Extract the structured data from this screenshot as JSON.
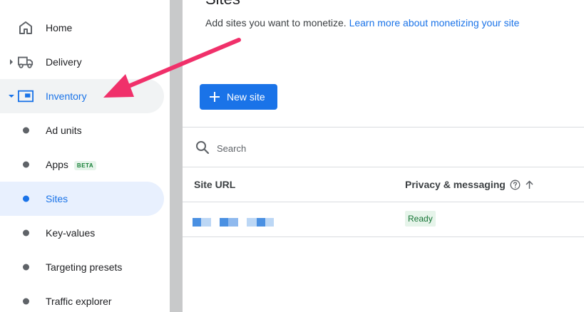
{
  "sidebar": {
    "items": [
      {
        "label": "Home",
        "icon": "home-icon"
      },
      {
        "label": "Delivery",
        "icon": "truck-icon"
      },
      {
        "label": "Inventory",
        "icon": "inventory-icon"
      },
      {
        "label": "Ad units"
      },
      {
        "label": "Apps",
        "badge": "BETA"
      },
      {
        "label": "Sites"
      },
      {
        "label": "Key-values"
      },
      {
        "label": "Targeting presets"
      },
      {
        "label": "Traffic explorer"
      }
    ]
  },
  "main": {
    "title": "Sites",
    "description": "Add sites you want to monetize.",
    "learn_more": "Learn more about monetizing your site",
    "new_button": "New site",
    "search": {
      "placeholder": "Search",
      "value": ""
    },
    "table": {
      "columns": [
        "Site URL",
        "Privacy & messaging"
      ],
      "rows": [
        {
          "site_url": "",
          "privacy_status": "Ready"
        }
      ]
    }
  },
  "colors": {
    "accent": "#1a73e8",
    "selected_bg": "#e8f0fe",
    "arrow": "#f0306a",
    "ready_text": "#137333",
    "ready_bg": "#e6f4ea"
  }
}
